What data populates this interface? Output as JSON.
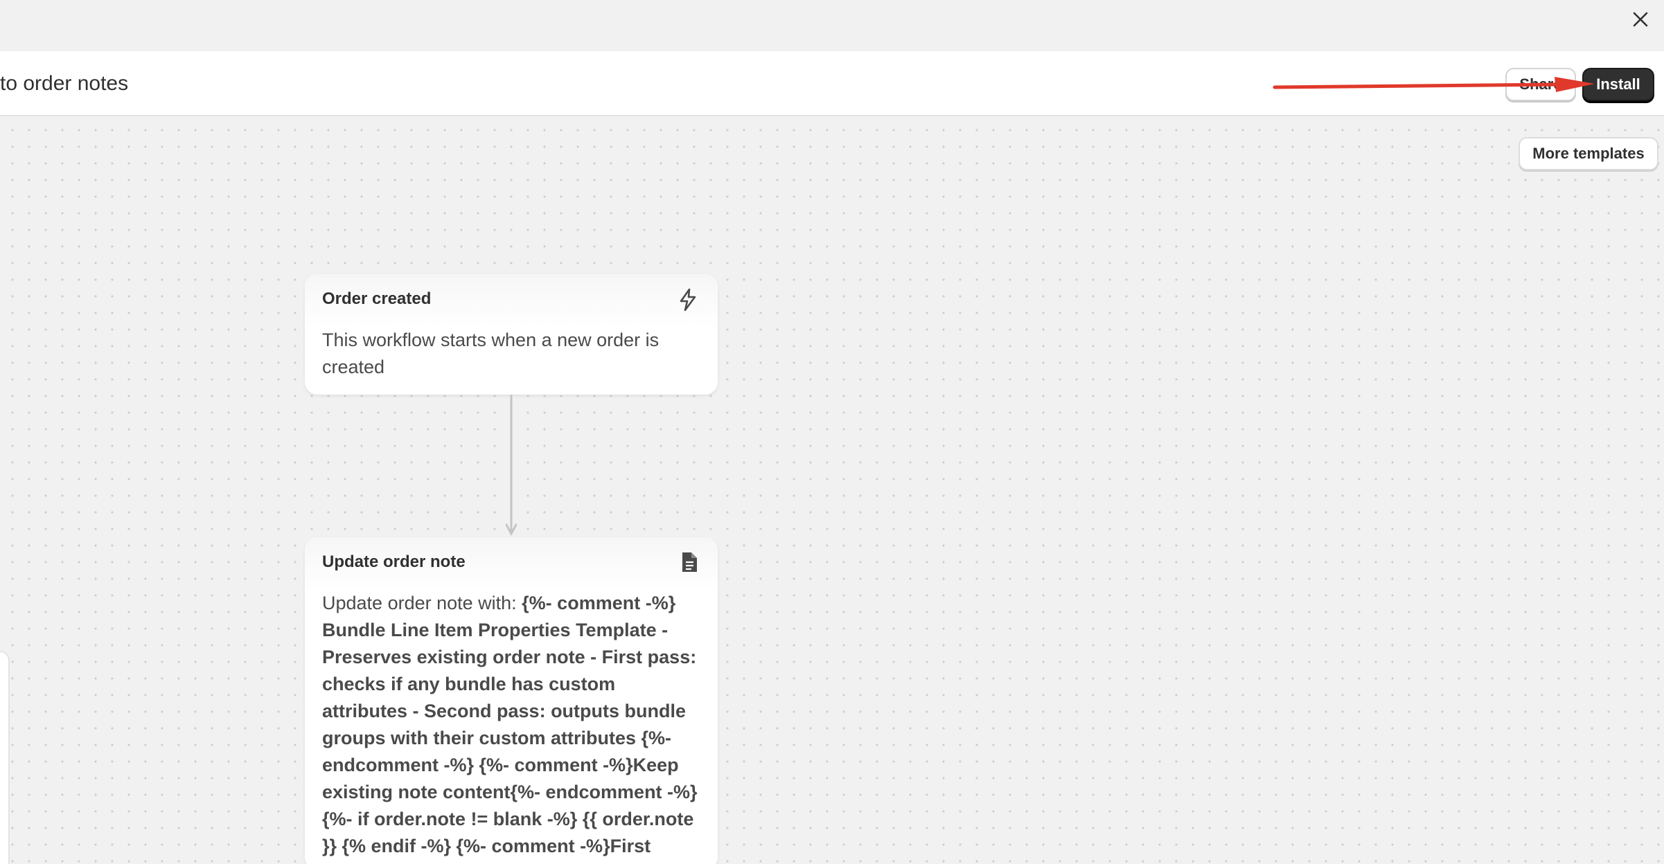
{
  "window": {
    "close_icon": "close-icon"
  },
  "header": {
    "title": "to order notes",
    "share_label": "Share",
    "install_label": "Install",
    "annotation_color": "#e0392b"
  },
  "canvas": {
    "more_templates_label": "More templates",
    "trigger": {
      "title": "Order created",
      "icon": "lightning-bolt-icon",
      "description": "This workflow starts when a new order is created"
    },
    "action": {
      "title": "Update order note",
      "icon": "document-icon",
      "prefix": "Update order note with: ",
      "code": "{%- comment -%} Bundle Line Item Properties Template - Preserves existing order note - First pass: checks if any bundle has custom attributes - Second pass: outputs bundle groups with their custom attributes {%- endcomment -%} {%- comment -%}Keep existing note content{%- endcomment -%} {%- if order.note != blank -%} {{ order.note }} {% endif -%} {%- comment -%}First pass: check if any bundle ..."
    }
  }
}
